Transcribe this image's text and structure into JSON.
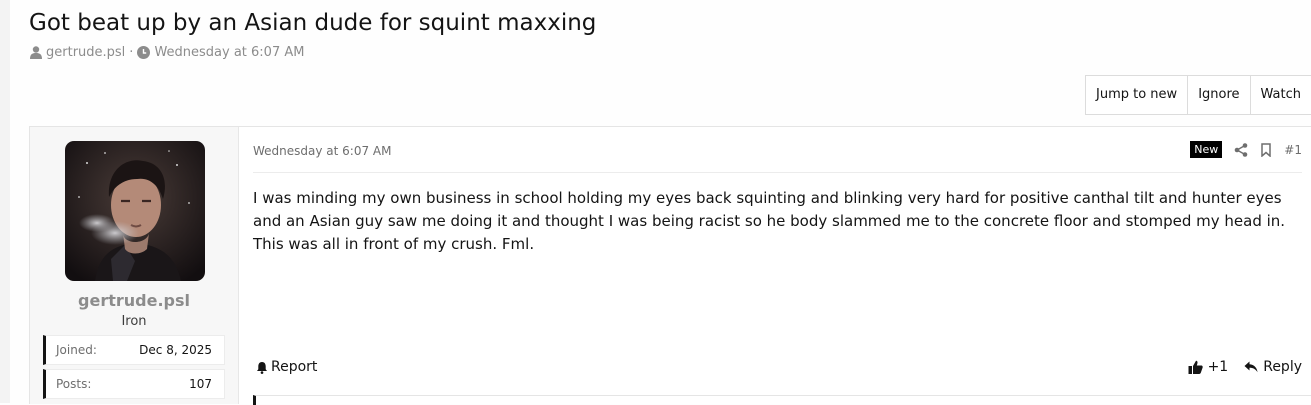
{
  "thread": {
    "title": "Got beat up by an Asian dude for squint maxxing",
    "author": "gertrude.psl",
    "separator": "·",
    "date": "Wednesday at 6:07 AM"
  },
  "toolbar": {
    "jump_to_new": "Jump to new",
    "ignore": "Ignore",
    "watch": "Watch"
  },
  "post": {
    "user": {
      "name": "gertrude.psl",
      "title": "Iron",
      "stats": [
        {
          "label": "Joined:",
          "value": "Dec 8, 2025"
        },
        {
          "label": "Posts:",
          "value": "107"
        }
      ]
    },
    "date": "Wednesday at 6:07 AM",
    "new_badge": "New",
    "number": "#1",
    "body": "I was minding my own business in school holding my eyes back squinting and blinking very hard for positive canthal tilt and hunter eyes and an Asian guy saw me doing it and thought I was being racist so he body slammed me to the concrete floor and stomped my head in. This was all in front of my crush. Fml.",
    "report": "Report",
    "reaction_count": "+1",
    "reply": "Reply"
  },
  "icons": {
    "user": "user-icon",
    "clock": "clock-icon",
    "share": "share-icon",
    "bookmark": "bookmark-icon",
    "bell": "bell-icon",
    "thumbs_up": "thumbs-up-icon",
    "reply": "reply-arrow-icon"
  },
  "colors": {
    "text": "#141414",
    "muted": "#8c8c8c",
    "new_badge_bg": "#000000"
  }
}
